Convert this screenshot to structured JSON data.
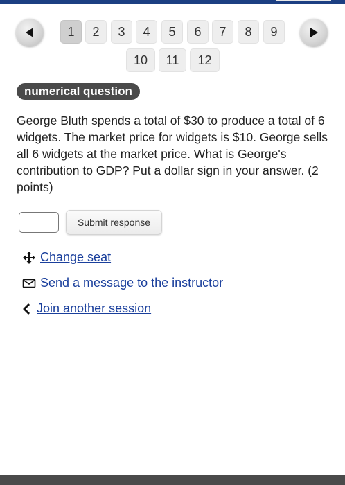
{
  "pagination": {
    "prev_icon": "left-arrow-icon",
    "next_icon": "right-arrow-icon",
    "pages": [
      "1",
      "2",
      "3",
      "4",
      "5",
      "6",
      "7",
      "8",
      "9",
      "10",
      "11",
      "12"
    ],
    "current_page": "1"
  },
  "question": {
    "type_label": "numerical question",
    "text": "George Bluth spends a total of $30 to produce a total of 6 widgets. The market price for widgets is $10. George sells all 6 widgets at the market price. What is George's contribution to GDP? Put a dollar sign in your answer. (2 points)"
  },
  "response": {
    "input_value": "",
    "submit_label": "Submit response"
  },
  "links": {
    "change_seat": {
      "label": "Change seat",
      "icon": "move-icon"
    },
    "message_instructor": {
      "label": "Send a message to the instructor",
      "icon": "envelope-icon"
    },
    "join_session": {
      "label": "Join another session",
      "icon": "chevron-left-icon"
    }
  },
  "colors": {
    "header_bar": "#1c3f82",
    "link": "#1a3f9c",
    "badge": "#4a4a4a",
    "active_page": "#cfcfcf"
  }
}
